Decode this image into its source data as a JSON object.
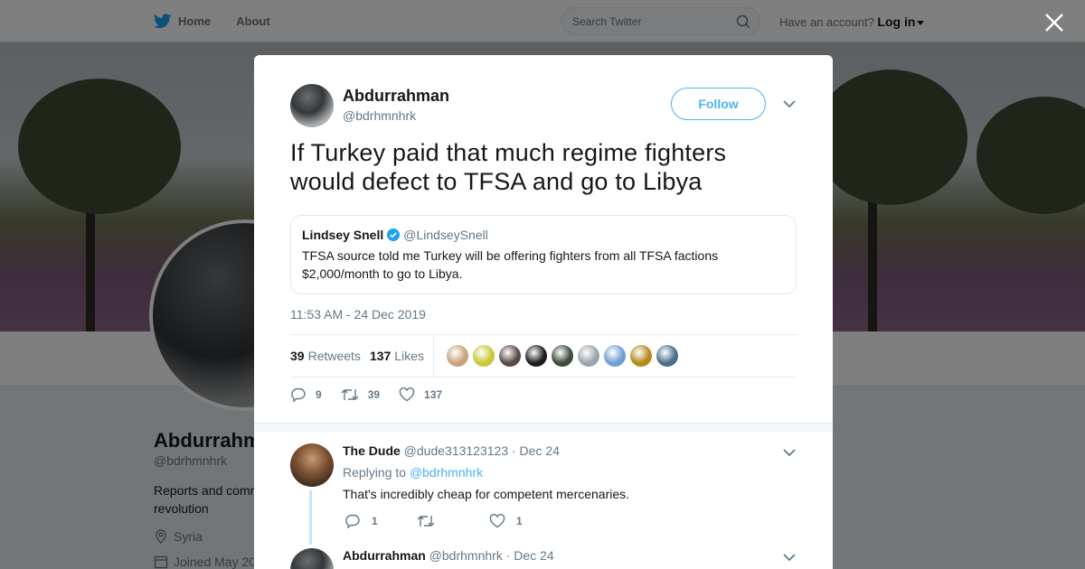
{
  "nav": {
    "home_label": "Home",
    "about_label": "About",
    "search_placeholder": "Search Twitter",
    "account_prompt": "Have an account?",
    "login_label": "Log in"
  },
  "profile": {
    "name": "Abdurrahman",
    "handle": "@bdrhmnhrk",
    "bio": "Reports and comm revolution",
    "location": "Syria",
    "joined": "Joined May 20"
  },
  "tweet": {
    "author_name": "Abdurrahman",
    "author_handle": "@bdrhmnhrk",
    "follow_label": "Follow",
    "text": "If Turkey paid that much regime fighters would defect to TFSA and go to Libya",
    "quote": {
      "name": "Lindsey Snell",
      "handle": "@LindseySnell",
      "text": "TFSA source told me Turkey will be offering fighters from all TFSA factions $2,000/month to go to Libya."
    },
    "timestamp": "11:53 AM - 24 Dec 2019",
    "retweets_count": "39",
    "retweets_label": "Retweets",
    "likes_count": "137",
    "likes_label": "Likes",
    "action_replies": "9",
    "action_retweets": "39",
    "action_likes": "137",
    "liker_colors": [
      "#c9a27a",
      "#c8c83a",
      "#5a4a44",
      "#1d1d1d",
      "#3c4a3a",
      "#9aa4ad",
      "#6f9fd1",
      "#b58a1a",
      "#4b6f8a"
    ]
  },
  "replies": [
    {
      "name": "The Dude",
      "handle": "@dude313123123",
      "date": "· Dec 24",
      "replying_prefix": "Replying to",
      "replying_to": "@bdrhmnhrk",
      "text": "That's incredibly cheap for competent mercenaries.",
      "reply_count": "1",
      "retweet_count": "",
      "like_count": "1"
    },
    {
      "name": "Abdurrahman",
      "handle": "@bdrhmnhrk",
      "date": "· Dec 24"
    }
  ]
}
